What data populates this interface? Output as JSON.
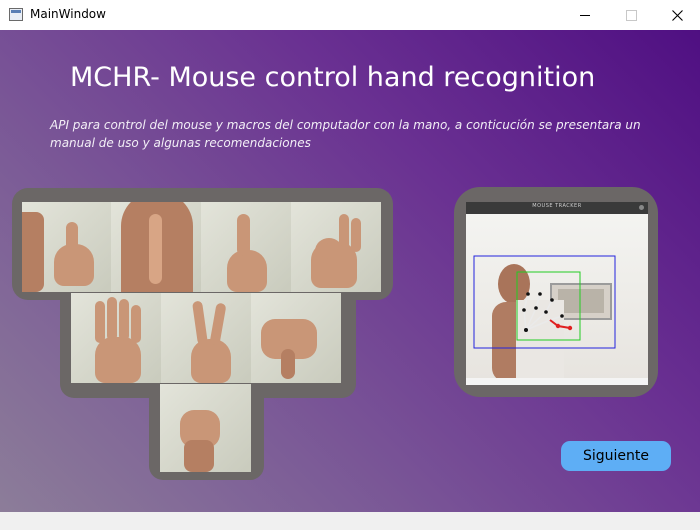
{
  "window": {
    "title": "MainWindow",
    "icon": "app-window-icon",
    "controls": [
      "minimize-icon",
      "maximize-icon",
      "close-icon"
    ]
  },
  "main": {
    "heading": "MCHR- Mouse control hand recognition",
    "description": "API para control del mouse y macros del computador con la mano, a conticución se presentara un manual de uso y algunas recomendaciones",
    "gesture_gallery": [
      "thumb-up-gesture",
      "shush-gesture",
      "index-up-gesture",
      "ok-gesture",
      "four-fingers-gesture",
      "peace-gesture",
      "thumb-side-gesture",
      "fist-gesture"
    ],
    "tracker_preview": {
      "window_title": "MOUSE TRACKER"
    },
    "next_button": "Siguiente"
  },
  "colors": {
    "gradient_dark": "#4f0f82",
    "gradient_light": "#8c7d99",
    "frame": "#6b6766",
    "button": "#5eaef5"
  }
}
